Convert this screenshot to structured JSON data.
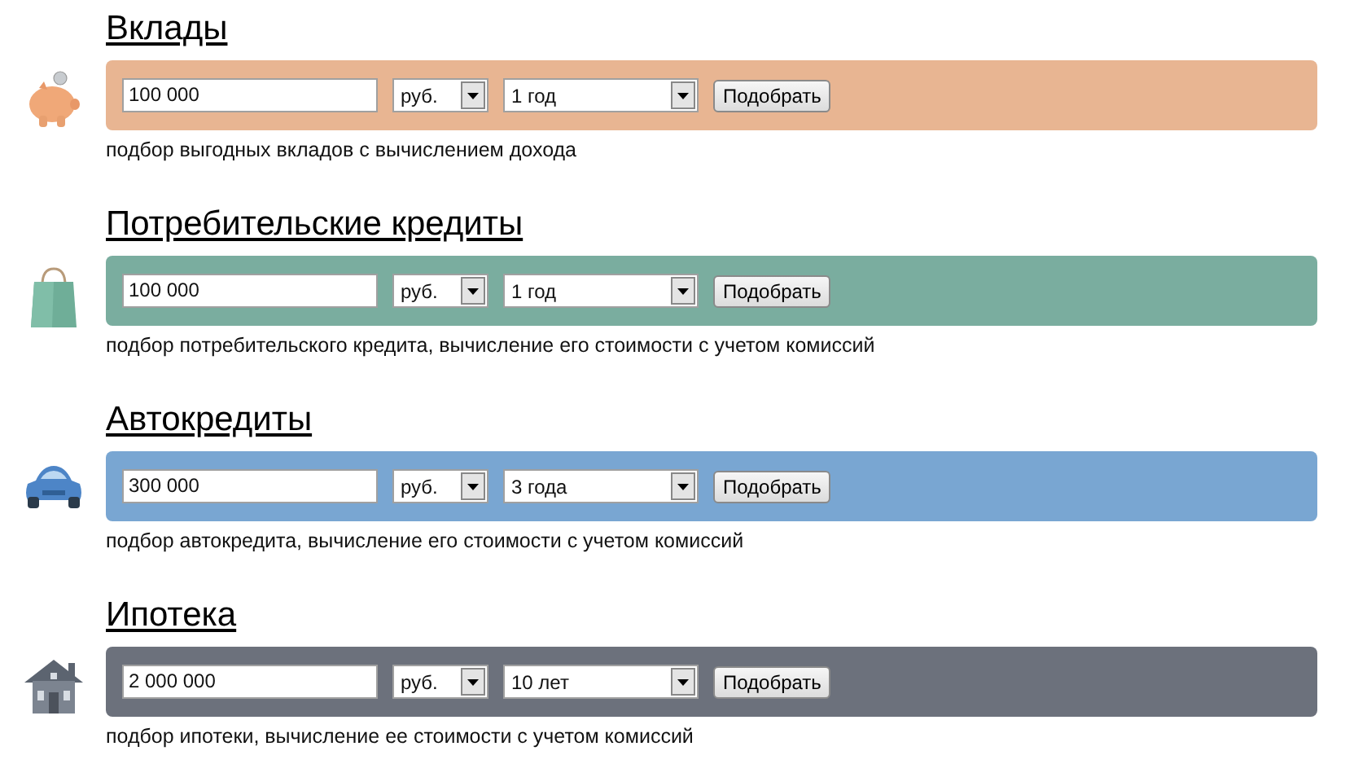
{
  "sections": [
    {
      "kind": "piggy",
      "title": "Вклады",
      "color": "#e8b592",
      "amount": "100 000",
      "currency": "руб.",
      "term": "1 год",
      "button": "Подобрать",
      "description": "подбор выгодных вкладов с вычислением дохода"
    },
    {
      "kind": "bag",
      "title": "Потребительские кредиты",
      "color": "#7aad9f",
      "amount": "100 000",
      "currency": "руб.",
      "term": "1 год",
      "button": "Подобрать",
      "description": "подбор потребительского кредита, вычисление его стоимости с учетом комиссий"
    },
    {
      "kind": "car",
      "title": "Автокредиты",
      "color": "#79a6d2",
      "amount": "300 000",
      "currency": "руб.",
      "term": "3 года",
      "button": "Подобрать",
      "description": "подбор автокредита, вычисление его стоимости с учетом комиссий"
    },
    {
      "kind": "house",
      "title": "Ипотека",
      "color": "#6c717c",
      "amount": "2 000 000",
      "currency": "руб.",
      "term": "10 лет",
      "button": "Подобрать",
      "description": "подбор ипотеки, вычисление ее стоимости с учетом комиссий"
    }
  ]
}
